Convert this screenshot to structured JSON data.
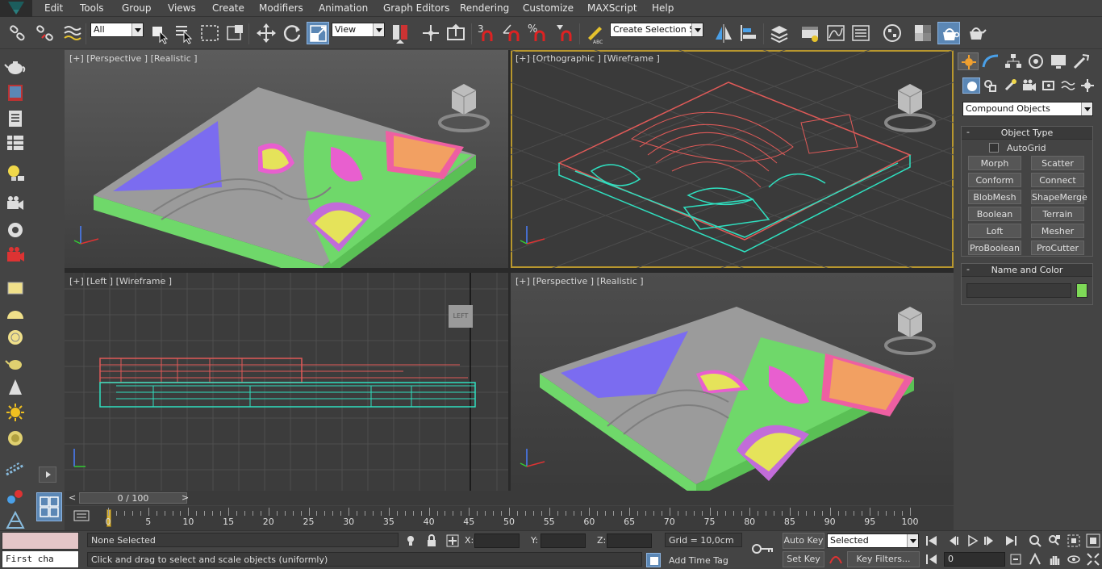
{
  "menu": [
    "Edit",
    "Tools",
    "Group",
    "Views",
    "Create",
    "Modifiers",
    "Animation",
    "Graph Editors",
    "Rendering",
    "Customize",
    "MAXScript",
    "Help"
  ],
  "toolbar": {
    "selection_filter": "All",
    "reference_coord": "View",
    "named_selection": "Create Selection Se",
    "snap_label_3": "3",
    "icons": [
      "link-icon",
      "unlink-icon",
      "bind-space-warp-icon",
      "select-object-icon",
      "select-by-name-icon",
      "rect-region-icon",
      "window-crossing-icon",
      "move-icon",
      "rotate-icon",
      "scale-icon",
      "pivot-icon",
      "manipulate-icon",
      "keyboard-shortcut-icon",
      "snap-toggle-icon",
      "angle-snap-icon",
      "percent-snap-icon",
      "spinner-snap-icon",
      "edit-named-selection-icon",
      "mirror-icon",
      "align-icon",
      "layer-manager-icon",
      "ribbon-icon",
      "curve-editor-icon",
      "schematic-view-icon",
      "material-editor-icon",
      "render-setup-icon",
      "rendered-frame-icon",
      "render-icon"
    ]
  },
  "viewports": {
    "top_left": "[+] [Perspective ] [Realistic ]",
    "top_right": "[+] [Orthographic ] [Wireframe ]",
    "bottom_left": "[+] [Left ] [Wireframe ]",
    "bottom_right": "[+] [Perspective ] [Realistic ]",
    "viewcube_left": "LEFT"
  },
  "command_panel": {
    "category": "Compound Objects",
    "object_type_title": "Object Type",
    "autogrid": "AutoGrid",
    "buttons": [
      "Morph",
      "Scatter",
      "Conform",
      "Connect",
      "BlobMesh",
      "ShapeMerge",
      "Boolean",
      "Terrain",
      "Loft",
      "Mesher",
      "ProBoolean",
      "ProCutter"
    ],
    "name_color_title": "Name and Color",
    "object_color": "#7ed957"
  },
  "time_slider": {
    "position": "0 / 100",
    "prev": "<",
    "next": ">"
  },
  "timeline": {
    "ticks": [
      "0",
      "5",
      "10",
      "15",
      "20",
      "25",
      "30",
      "35",
      "40",
      "45",
      "50",
      "55",
      "60",
      "65",
      "70",
      "75",
      "80",
      "85",
      "90",
      "95",
      "100"
    ]
  },
  "status": {
    "maxscript_listener": "First cha",
    "selection_status": "None Selected",
    "prompt": "Click and drag to select and scale objects (uniformly)",
    "x_label": "X:",
    "y_label": "Y:",
    "z_label": "Z:",
    "grid": "Grid = 10,0cm",
    "add_time_tag": "Add Time Tag",
    "auto_key": "Auto Key",
    "set_key": "Set Key",
    "key_mode": "Selected",
    "key_filters": "Key Filters...",
    "current_frame": "0"
  },
  "colors": {
    "pool_blue": "#7b6cf0",
    "terrain_gray": "#9b9b9b",
    "grass_green": "#6fd86a",
    "pink_rim": "#ee5fa2",
    "orange": "#f2a062",
    "wire_red": "#e05a58",
    "wire_cyan": "#2fe0c0",
    "active_border": "#b8972e"
  }
}
